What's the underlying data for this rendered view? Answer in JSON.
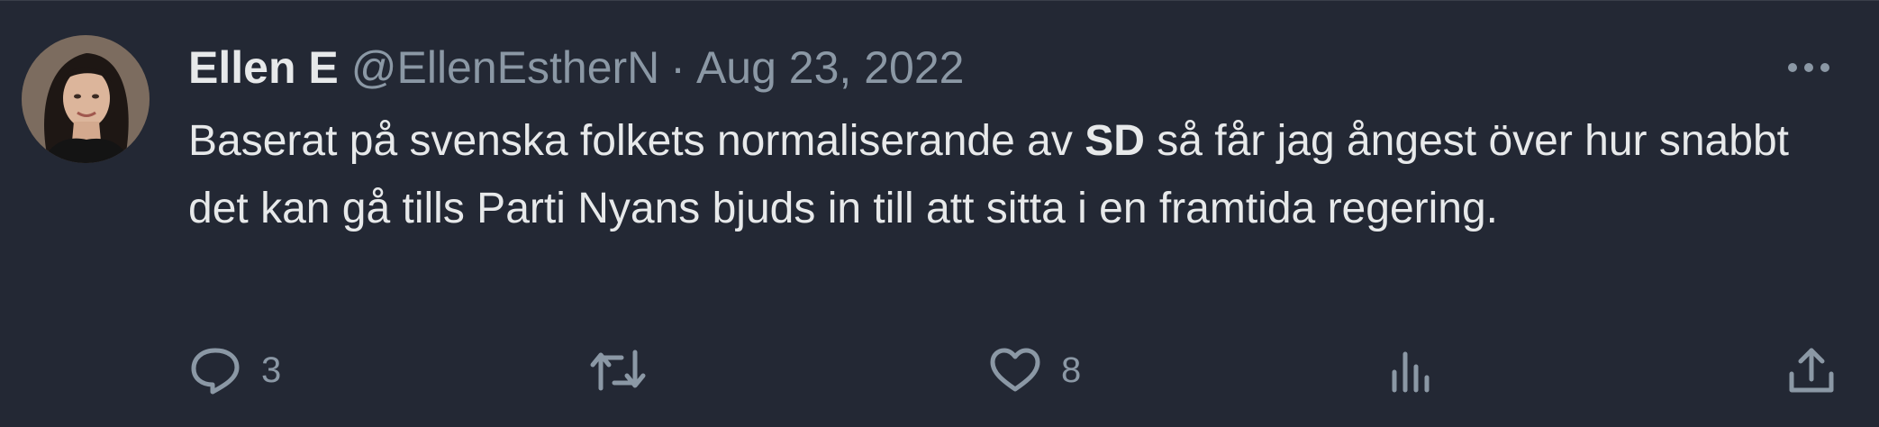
{
  "author": {
    "name": "Ellen E",
    "handle": "@EllenEstherN",
    "separator": "·",
    "date": "Aug 23, 2022"
  },
  "tweet": {
    "text_before": "Baserat på svenska folkets normaliserande av ",
    "text_bold": "SD",
    "text_after": " så får jag ångest över hur snabbt det kan gå tills Parti Nyans bjuds in till att sitta i en framtida regering."
  },
  "actions": {
    "reply_count": "3",
    "retweet_count": "",
    "like_count": "8"
  },
  "icons": {
    "more": "more-horizontal-icon",
    "reply": "reply-icon",
    "retweet": "retweet-icon",
    "like": "heart-icon",
    "views": "analytics-icon",
    "share": "share-icon"
  },
  "colors": {
    "background": "#232834",
    "text": "#e7e9ea",
    "secondary": "#8b98a5"
  }
}
